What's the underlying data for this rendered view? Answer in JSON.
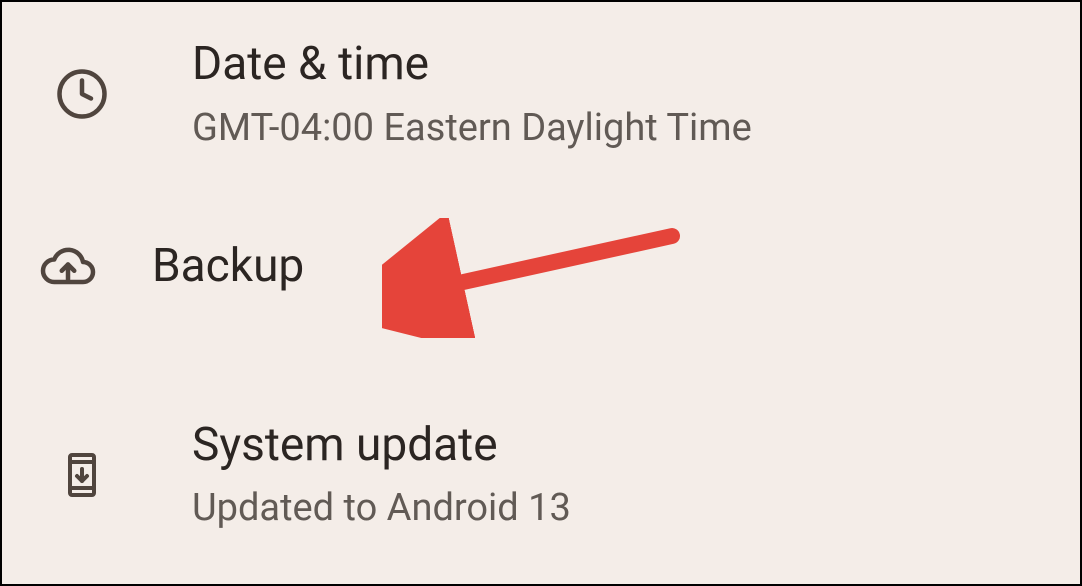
{
  "settings": {
    "date_time": {
      "title": "Date & time",
      "subtitle": "GMT-04:00 Eastern Daylight Time"
    },
    "backup": {
      "title": "Backup"
    },
    "system_update": {
      "title": "System update",
      "subtitle": "Updated to Android 13"
    }
  },
  "colors": {
    "icon": "#50453e",
    "arrow": "#e5443a"
  }
}
